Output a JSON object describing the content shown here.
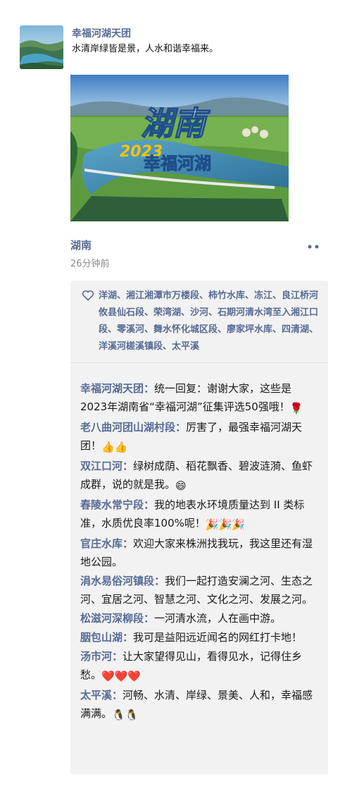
{
  "post": {
    "author": "幸福河湖天团",
    "text": "水清岸绿皆是景，人水和谐幸福来。",
    "image": {
      "title_line1": "湖南",
      "year": "2023",
      "title_line2": "幸福河湖"
    },
    "location": "湖南",
    "time": "26分钟前",
    "likes": "洋湖、湘江湘潭市万楼段、柿竹水库、冻江、良江桥河攸县仙石段、荣湾湖、沙河、石期河清水湾至入湘江口段、零溪河、舞水怀化城区段、廖家坪水库、四清湖、洋溪河槎溪镇段、太平溪"
  },
  "comments": [
    {
      "author": "幸福河湖天团：",
      "text": "统一回复：谢谢大家，这些是2023年湖南省“幸福河湖”征集评选50强哦！",
      "emoji": "🌹"
    },
    {
      "author": "老八曲河团山湖村段：",
      "text": "厉害了，最强幸福河湖天团！",
      "emoji": "👍👍"
    },
    {
      "author": "双江口河：",
      "text": "绿树成荫、稻花飘香、碧波涟漪、鱼虾成群，说的就是我。",
      "emoji": "😄"
    },
    {
      "author": "春陵水常宁段：",
      "text": "我的地表水环境质量达到 II 类标准，水质优良率100%呢！",
      "emoji": "🎉🎉🎉"
    },
    {
      "author": "官庄水库：",
      "text": "欢迎大家来株洲找我玩，我这里还有湿地公园。",
      "emoji": ""
    },
    {
      "author": "涓水易俗河镇段：",
      "text": "我们一起打造安澜之河、生态之河、宜居之河、智慧之河、文化之河、发展之河。",
      "emoji": ""
    },
    {
      "author": "松滋河深柳段：",
      "text": "一河清水流，人在画中游。",
      "emoji": ""
    },
    {
      "author": "胭包山湖：",
      "text": "我可是益阳远近闻名的网红打卡地！",
      "emoji": ""
    },
    {
      "author": "汤市河：",
      "text": "让大家望得见山，看得见水，记得住乡愁。",
      "emoji": "❤️❤️❤️"
    },
    {
      "author": "太平溪：",
      "text": "河畅、水清、岸绿、景美、人和，幸福感满满。",
      "emoji": "🐧🐧"
    }
  ],
  "icons": {
    "like": "heart-outline-icon",
    "more": "more-dots-icon"
  },
  "colors": {
    "link": "#576b95",
    "panel": "#f2f2f2",
    "meta": "#8a8a8a"
  }
}
